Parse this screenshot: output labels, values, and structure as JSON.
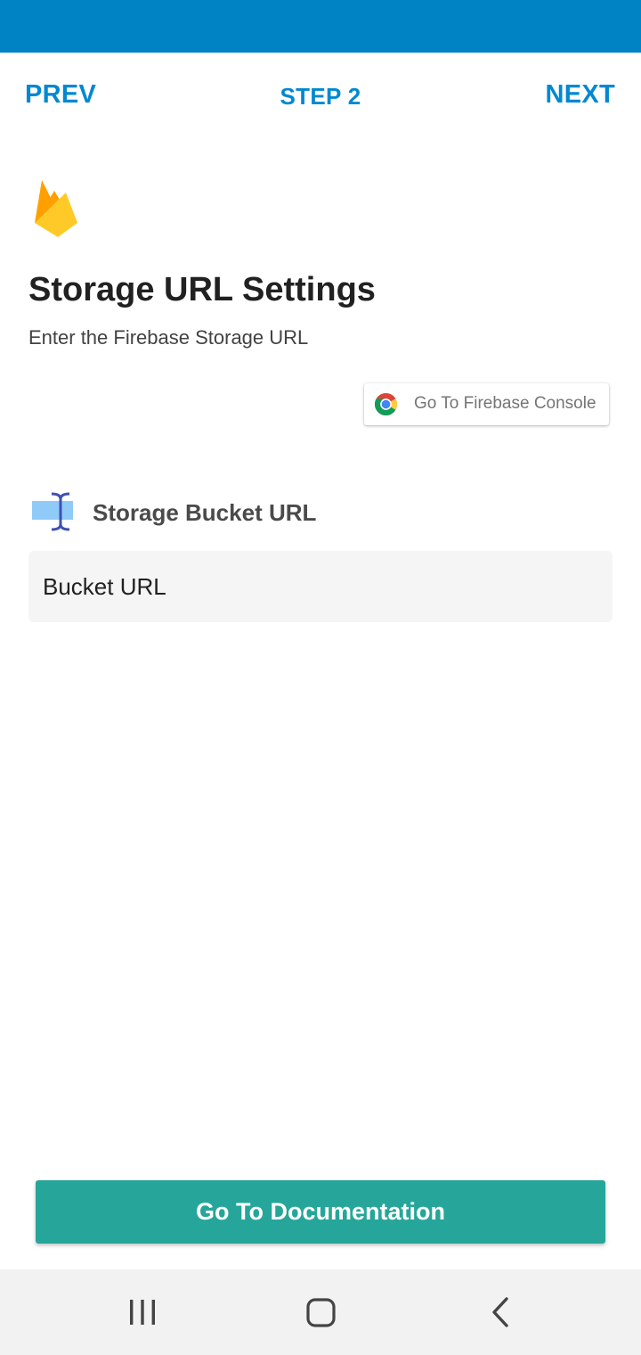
{
  "header": {
    "prev_label": "PREV",
    "step_label": "STEP 2",
    "next_label": "NEXT"
  },
  "content": {
    "logo_icon": "firebase-flame-icon",
    "title": "Storage URL Settings",
    "subtitle": "Enter the Firebase Storage URL",
    "console_button": {
      "icon": "chrome-icon",
      "label": "Go To Firebase Console"
    },
    "bucket_section": {
      "icon": "text-cursor-icon",
      "label": "Storage Bucket URL",
      "input_value": "",
      "input_placeholder": "Bucket URL"
    },
    "doc_button_label": "Go To Documentation"
  },
  "system_nav": {
    "recents_icon": "recents-icon",
    "home_icon": "home-icon",
    "back_icon": "back-icon"
  },
  "colors": {
    "status_bar": "#0083C4",
    "accent": "#0288D1",
    "primary_button": "#26A69A",
    "input_background": "#F5F5F5",
    "nav_bar": "#F2F2F2"
  }
}
